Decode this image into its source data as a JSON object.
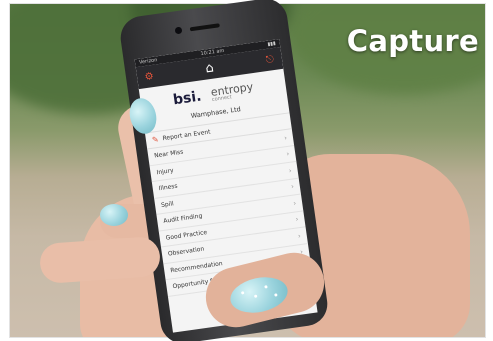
{
  "caption": "Capture",
  "app": {
    "status_left": "Verizon",
    "status_time": "10:21 am",
    "status_right": "▮▮▮",
    "brand_left": "bsi.",
    "brand_right": "entropy",
    "brand_right_sub": "connect",
    "site_name": "Wamphase, Ltd",
    "report_label": "Report an Event",
    "menu_items": [
      "Near Miss",
      "Injury",
      "Illness",
      "Spill",
      "Audit Finding",
      "Good Practice",
      "Observation",
      "Recommendation",
      "Opportunity for Improvement"
    ],
    "icons": {
      "left": "settings-icon",
      "center": "home-icon",
      "right": "logout-icon",
      "report": "edit-icon",
      "chevron": "chevron-right-icon"
    },
    "accent_color": "#e0543b"
  },
  "nail_color": "#9ad3dd"
}
